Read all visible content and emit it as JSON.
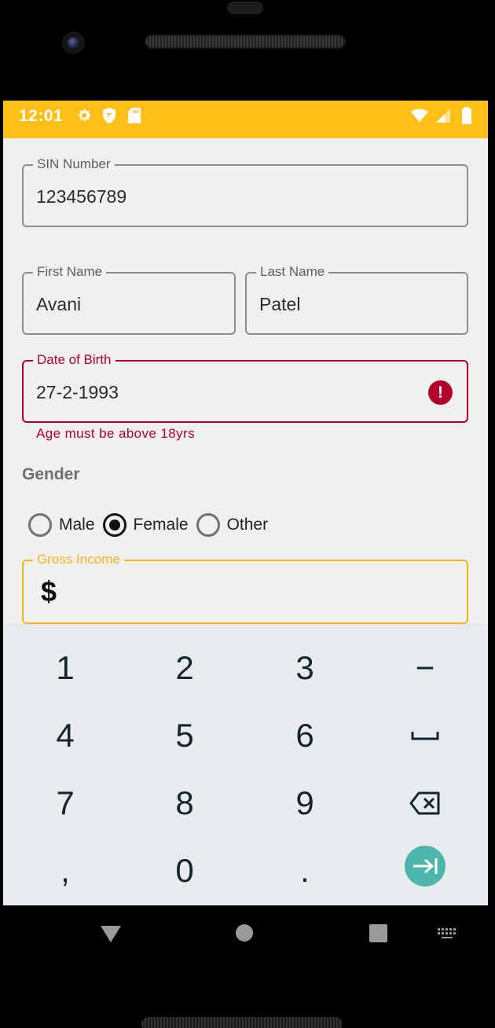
{
  "status_bar": {
    "time": "12:01",
    "left_icons": [
      "gear-icon",
      "shield-icon",
      "sd-card-icon"
    ],
    "right_icons": [
      "wifi-icon",
      "cell-signal-icon",
      "battery-icon"
    ],
    "background": "#ffbf17"
  },
  "form": {
    "sin": {
      "label": "SIN Number",
      "value": "123456789"
    },
    "first_name": {
      "label": "First Name",
      "value": "Avani"
    },
    "last_name": {
      "label": "Last Name",
      "value": "Patel"
    },
    "dob": {
      "label": "Date of Birth",
      "value": "27-2-1993",
      "error": "Age must be above 18yrs",
      "error_icon": "!"
    },
    "gender": {
      "label": "Gender",
      "options": [
        {
          "label": "Male",
          "checked": false
        },
        {
          "label": "Female",
          "checked": true
        },
        {
          "label": "Other",
          "checked": false
        }
      ]
    },
    "gross_income": {
      "label": "Gross Income",
      "prefix": "$",
      "value": ""
    }
  },
  "keypad": {
    "rows": [
      [
        "1",
        "2",
        "3",
        "−"
      ],
      [
        "4",
        "5",
        "6",
        "space-icon"
      ],
      [
        "7",
        "8",
        "9",
        "backspace-icon"
      ],
      [
        ",",
        "0",
        ".",
        "next-field-icon"
      ]
    ],
    "enter_color": "#4db6ac"
  },
  "colors": {
    "error": "#b0002a",
    "focus": "#f2b51e",
    "accent": "#ffbf17"
  }
}
